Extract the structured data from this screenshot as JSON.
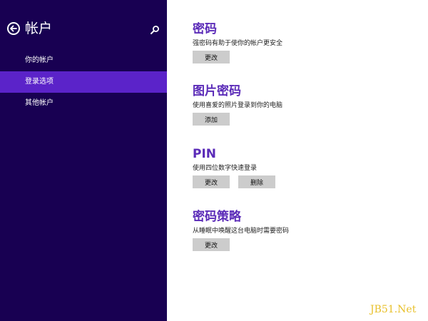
{
  "sidebar": {
    "title": "帐户",
    "back_icon": "back-arrow-icon",
    "search_icon": "search-icon",
    "items": [
      {
        "label": "你的帐户",
        "active": false
      },
      {
        "label": "登录选项",
        "active": true
      },
      {
        "label": "其他帐户",
        "active": false
      }
    ]
  },
  "sections": {
    "password": {
      "title": "密码",
      "description": "强密码有助于使你的帐户更安全",
      "change_label": "更改"
    },
    "picture_password": {
      "title": "图片密码",
      "description": "使用喜爱的照片登录到你的电脑",
      "add_label": "添加"
    },
    "pin": {
      "title": "PIN",
      "description": "使用四位数字快速登录",
      "change_label": "更改",
      "remove_label": "删除"
    },
    "password_policy": {
      "title": "密码策略",
      "description": "从睡眠中唤醒这台电脑时需要密码",
      "change_label": "更改"
    }
  },
  "watermark": "JB51.Net",
  "colors": {
    "sidebar_bg": "#180052",
    "nav_active": "#5b23c9",
    "accent_title": "#5b2bb8",
    "button_bg": "#cccccc",
    "watermark": "#e8c02a"
  }
}
